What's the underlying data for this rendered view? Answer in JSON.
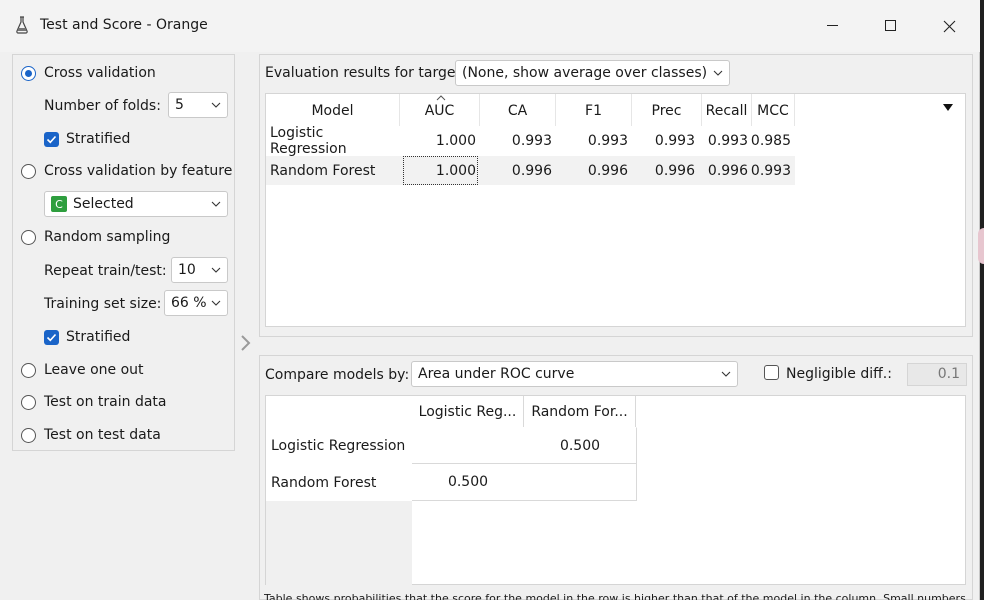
{
  "window": {
    "title": "Test and Score - Orange",
    "controls": {
      "minimize": "minimize-icon",
      "maximize": "maximize-icon",
      "close": "close-icon"
    }
  },
  "sampling": {
    "cross_validation": {
      "label": "Cross validation",
      "checked": true
    },
    "folds": {
      "label": "Number of folds:",
      "value": "5"
    },
    "stratified_cv": {
      "label": "Stratified",
      "checked": true
    },
    "cv_by_feature": {
      "label": "Cross validation by feature",
      "checked": false
    },
    "feature": {
      "badge": "C",
      "value": "Selected"
    },
    "random_sampling": {
      "label": "Random sampling",
      "checked": false
    },
    "repeat": {
      "label": "Repeat train/test:",
      "value": "10"
    },
    "train_size": {
      "label": "Training set size:",
      "value": "66 %"
    },
    "stratified_rs": {
      "label": "Stratified",
      "checked": true
    },
    "leave_one_out": {
      "label": "Leave one out",
      "checked": false
    },
    "test_on_train": {
      "label": "Test on train data",
      "checked": false
    },
    "test_on_test": {
      "label": "Test on test data",
      "checked": false
    }
  },
  "evaluation": {
    "target_label": "Evaluation results for target",
    "target_value": "(None, show average over classes)",
    "columns": [
      "Model",
      "AUC",
      "CA",
      "F1",
      "Prec",
      "Recall",
      "MCC"
    ],
    "rows": [
      {
        "model": "Logistic Regression",
        "auc": "1.000",
        "ca": "0.993",
        "f1": "0.993",
        "prec": "0.993",
        "recall": "0.993",
        "mcc": "0.985"
      },
      {
        "model": "Random Forest",
        "auc": "1.000",
        "ca": "0.996",
        "f1": "0.996",
        "prec": "0.996",
        "recall": "0.996",
        "mcc": "0.993"
      }
    ]
  },
  "compare": {
    "label": "Compare models by:",
    "value": "Area under ROC curve",
    "negligible_label": "Negligible diff.:",
    "negligible_checked": false,
    "negligible_value": "0.1",
    "col_headers": [
      "Logistic Reg...",
      "Random For..."
    ],
    "row_headers": [
      "Logistic Regression",
      "Random Forest"
    ],
    "cells": [
      [
        "",
        "0.500"
      ],
      [
        "0.500",
        ""
      ]
    ],
    "footnote": "Table shows probabilities that the score for the model in the row is higher than that of the model in the column. Small numbers"
  },
  "colors": {
    "accent": "#1a64c8",
    "feature_badge": "#2e9e3e",
    "row_alt": "#f2f2f2"
  }
}
